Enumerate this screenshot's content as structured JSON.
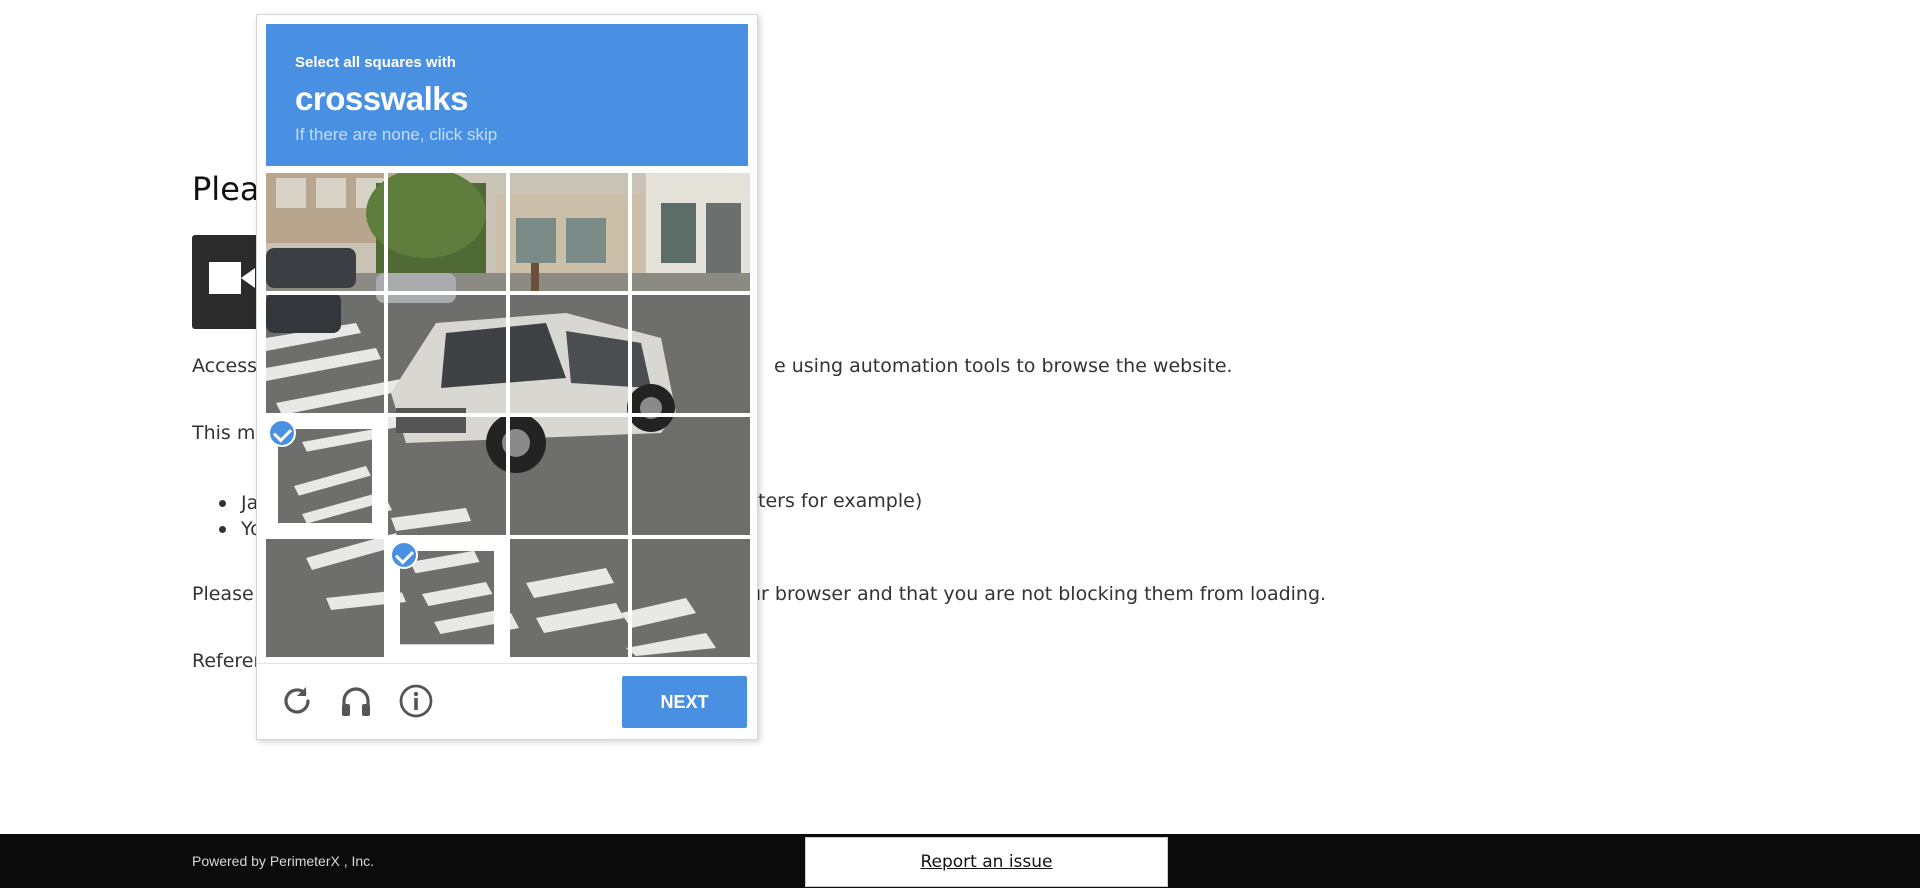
{
  "background": {
    "title": "Pleas",
    "access_line": {
      "left": "Access",
      "right": "e using automation tools to browse the website."
    },
    "may_line": "This ma",
    "bullets": [
      {
        "left": "Ja",
        "right": "ters for example)"
      },
      {
        "left": "Yo",
        "right": ""
      }
    ],
    "please_line": {
      "left": "Please",
      "right": "ur browser and that you are not blocking them from loading."
    },
    "reference_line": "Referer"
  },
  "footer": {
    "powered_by": "Powered by PerimeterX , Inc.",
    "report_label": "Report an issue"
  },
  "captcha": {
    "instruction": "Select all squares with",
    "target": "crosswalks",
    "hint": "If there are none, click skip",
    "selected_tiles": [
      8,
      13
    ],
    "next_label": "NEXT",
    "tools": [
      "reload-icon",
      "audio-icon",
      "info-icon"
    ],
    "colors": {
      "accent": "#4a90e2"
    }
  }
}
